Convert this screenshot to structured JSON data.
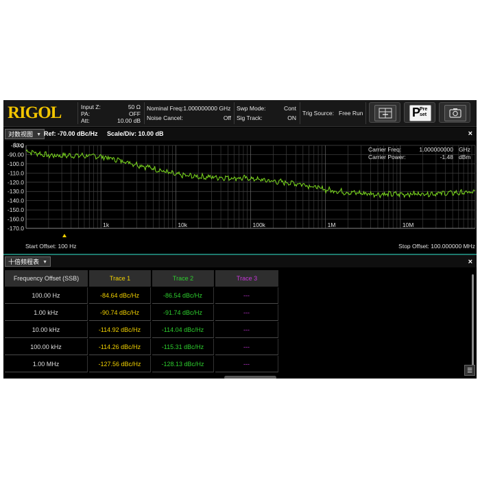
{
  "header": {
    "logo": "RIGOL",
    "input_z_label": "Input Z:",
    "input_z_value": "50 Ω",
    "pa_label": "PA:",
    "pa_value": "OFF",
    "att_label": "Att:",
    "att_value": "10.00 dB",
    "nominal_freq": "Nominal Freq:1.000000000 GHz",
    "noise_cancel_label": "Noise Cancel:",
    "noise_cancel_value": "Off",
    "swp_mode_label": "Swp Mode:",
    "swp_mode_value": "Cont",
    "sig_track_label": "Sig Track:",
    "sig_track_value": "ON",
    "trig_source_label": "Trig Source:",
    "trig_source_value": "Free Run",
    "preset_line1": "Pre",
    "preset_line2": "set",
    "preset_letter": "P"
  },
  "trace_window": {
    "view_dropdown": "对数视图",
    "ref": "Ref: -70.00 dBc/Hz",
    "scale": "Scale/Div: 10.00 dB",
    "close": "×",
    "carrier_freq_label": "Carrier Freq:",
    "carrier_freq_value": "1.000000000",
    "carrier_freq_unit": "GHz",
    "carrier_power_label": "Carrier Power:",
    "carrier_power_value": "-1.48",
    "carrier_power_unit": "dBm",
    "start_offset": "Start Offset: 100 Hz",
    "stop_offset": "Stop Offset: 100.000000 MHz"
  },
  "chart_data": {
    "type": "line",
    "xscale": "log",
    "xlim_hz": [
      100,
      100000000
    ],
    "ylim": [
      -170,
      -80
    ],
    "y_ticks": [
      "Log",
      "-80.0",
      "-90.00",
      "-100.0",
      "-110.0",
      "-120.0",
      "-130.0",
      "-140.0",
      "-150.0",
      "-160.0",
      "-170.0"
    ],
    "x_tick_labels": [
      "1k",
      "10k",
      "100k",
      "1M",
      "10M"
    ],
    "grid": true,
    "line_color": "#7ddc1f",
    "series_points": [
      [
        100,
        -86
      ],
      [
        200,
        -91
      ],
      [
        500,
        -91
      ],
      [
        1000,
        -92
      ],
      [
        2000,
        -97
      ],
      [
        5000,
        -105
      ],
      [
        10000,
        -112
      ],
      [
        20000,
        -114
      ],
      [
        50000,
        -115
      ],
      [
        100000,
        -116
      ],
      [
        200000,
        -119
      ],
      [
        500000,
        -122
      ],
      [
        1000000,
        -128
      ],
      [
        2000000,
        -131
      ],
      [
        5000000,
        -133
      ],
      [
        10000000,
        -133
      ],
      [
        100000000,
        -131
      ]
    ]
  },
  "table_window": {
    "dropdown": "十倍频程表",
    "close": "×",
    "columns": [
      {
        "label": "Frequency Offset (SSB)",
        "color": "#e0e0e0"
      },
      {
        "label": "Trace 1",
        "color": "#f2d200"
      },
      {
        "label": "Trace 2",
        "color": "#2ecf2e"
      },
      {
        "label": "Trace 3",
        "color": "#c635d8"
      }
    ],
    "rows": [
      [
        "100.00 Hz",
        "-84.64 dBc/Hz",
        "-86.54 dBc/Hz",
        "---"
      ],
      [
        "1.00 kHz",
        "-90.74 dBc/Hz",
        "-91.74 dBc/Hz",
        "---"
      ],
      [
        "10.00 kHz",
        "-114.92 dBc/Hz",
        "-114.04 dBc/Hz",
        "---"
      ],
      [
        "100.00 kHz",
        "-114.26 dBc/Hz",
        "-115.31 dBc/Hz",
        "---"
      ],
      [
        "1.00 MHz",
        "-127.56 dBc/Hz",
        "-128.13 dBc/Hz",
        "---"
      ]
    ],
    "panel_icon": "collapse-panel-icon"
  }
}
